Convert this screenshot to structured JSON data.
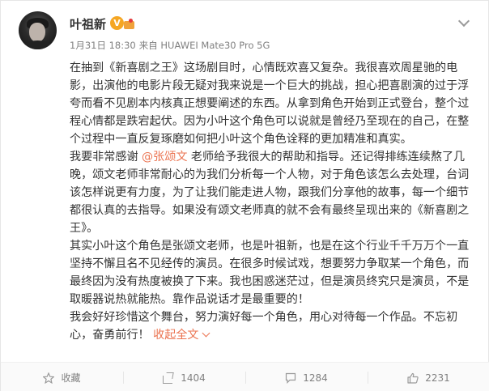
{
  "author": {
    "name": "叶祖新",
    "verified_badge": "V",
    "avatar_icon": "avatar-photo"
  },
  "meta": {
    "time": "1月31日 18:30",
    "source": "来自 HUAWEI Mate30 Pro 5G"
  },
  "content": {
    "p1": "在抽到《新喜剧之王》这场剧目时，心情既欢喜又复杂。我很喜欢周星驰的电影，出演他的电影片段无疑对我来说是一个巨大的挑战，担心把喜剧演的过于浮夸而看不见剧本内核真正想要阐述的东西。从拿到角色开始到正式登台，整个过程心情都是跌宕起伏。因为小叶这个角色可以说就是曾经乃至现在的自己，在整个过程中一直反复琢磨如何把小叶这个角色诠释的更加精准和真实。",
    "p2_before": "我要非常感谢 ",
    "mention": "@张颂文",
    "p2_after": " 老师给予我很大的帮助和指导。还记得排练连续熬了几晚，颂文老师非常耐心的为我们分析每一个人物，对于角色该怎么去处理，台词该怎样说更有力度，为了让我们能走进人物，跟我们分享他的故事，每一个细节都很认真的去指导。如果没有颂文老师真的就不会有最终呈现出来的《新喜剧之王》。",
    "p3": "其实小叶这个角色是张颂文老师，也是叶祖新，也是在这个行业千千万万个一直坚持不懈且名不见经传的演员。在很多时候试戏，想要努力争取某一个角色，而最终因为没有热度被换了下来。我也困惑迷茫过，但是演员终究只是演员，不是取暖器说热就能热。靠作品说话才是最重要的！",
    "p4": "我会好好珍惜这个舞台，努力演好每一个角色，用心对待每一个作品。不忘初心，奋勇前行！",
    "expand_label": "收起全文"
  },
  "actions": {
    "favorite_label": "收藏",
    "share_count": "1404",
    "comment_count": "1284",
    "like_count": "2231"
  },
  "colors": {
    "link": "#eb7350",
    "badge": "#f5a623"
  }
}
